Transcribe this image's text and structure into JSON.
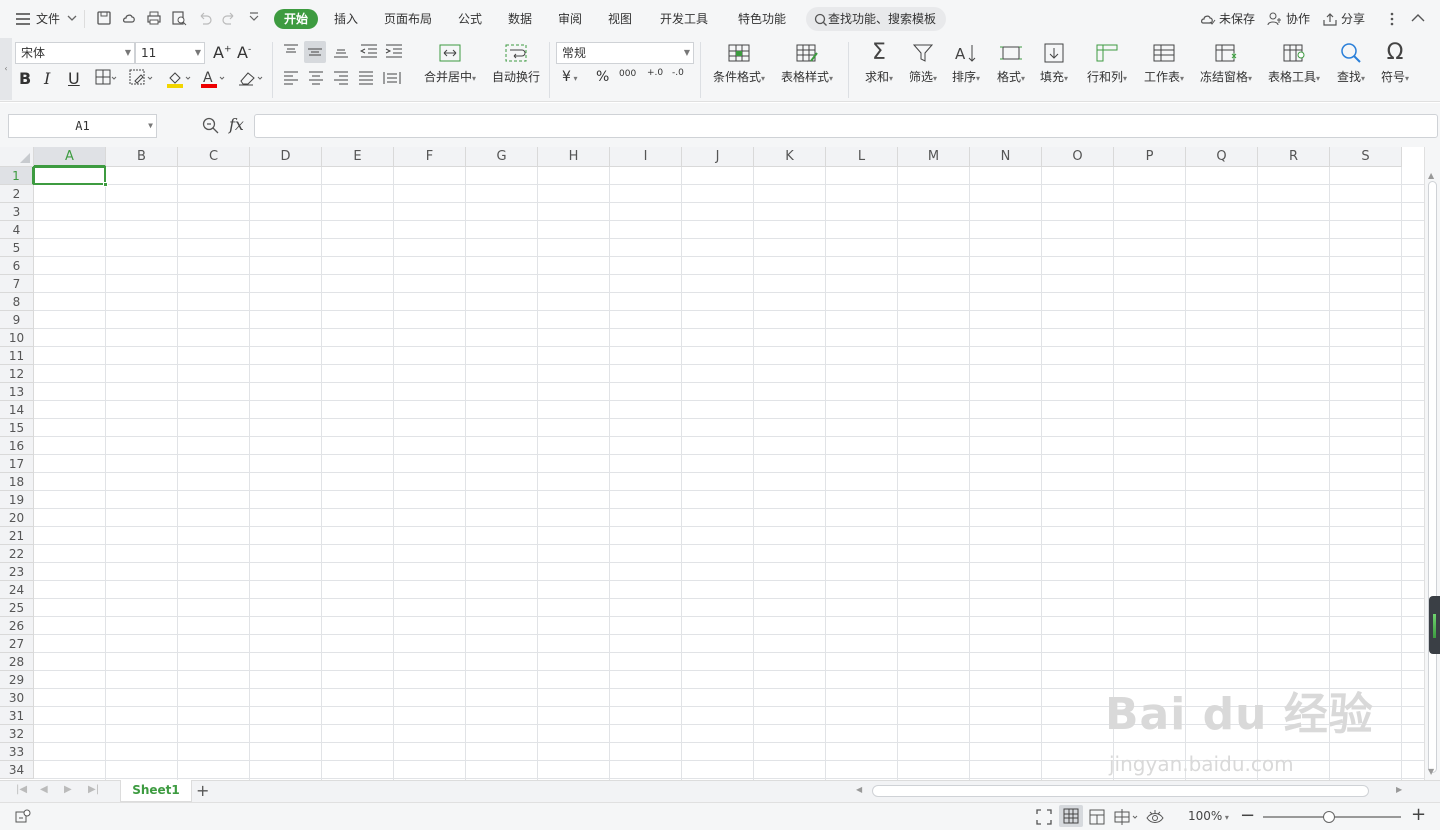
{
  "titlebar": {
    "file_menu": "文件",
    "tabs": [
      "开始",
      "插入",
      "页面布局",
      "公式",
      "数据",
      "审阅",
      "视图",
      "开发工具",
      "特色功能"
    ],
    "search_placeholder": "查找功能、搜索模板",
    "unsaved": "未保存",
    "collaborate": "协作",
    "share": "分享"
  },
  "ribbon": {
    "font_name": "宋体",
    "font_size": "11",
    "merge_center": "合并居中",
    "wrap_text": "自动换行",
    "number_format": "常规",
    "currency_symbol": "¥",
    "percent_symbol": "%",
    "thousands_symbol": "000",
    "decimal_increase": "+.0",
    "decimal_decrease": "-.0",
    "conditional_format": "条件格式",
    "table_style": "表格样式",
    "sum": "求和",
    "filter": "筛选",
    "sort": "排序",
    "format": "格式",
    "fill": "填充",
    "row_col": "行和列",
    "worksheet": "工作表",
    "freeze": "冻结窗格",
    "table_tools": "表格工具",
    "find": "查找",
    "symbol": "符号"
  },
  "formula_bar": {
    "cell_ref": "A1",
    "fx_label": "fx",
    "value": ""
  },
  "sheet": {
    "columns": [
      "A",
      "B",
      "C",
      "D",
      "E",
      "F",
      "G",
      "H",
      "I",
      "J",
      "K",
      "L",
      "M",
      "N",
      "O",
      "P",
      "Q",
      "R",
      "S"
    ],
    "rows": [
      "1",
      "2",
      "3",
      "4",
      "5",
      "6",
      "7",
      "8",
      "9",
      "10",
      "11",
      "12",
      "13",
      "14",
      "15",
      "16",
      "17",
      "18",
      "19",
      "20",
      "21",
      "22",
      "23",
      "24",
      "25",
      "26",
      "27",
      "28",
      "29",
      "30",
      "31",
      "32",
      "33",
      "34"
    ],
    "active_cell": "A1"
  },
  "sheet_tabs": [
    "Sheet1"
  ],
  "status": {
    "zoom": "100%"
  },
  "watermark": {
    "brand": "Bai du 经验",
    "url": "jingyan.baidu.com"
  },
  "colors": {
    "accent": "#3d9b40",
    "grid_line": "#e1e3e6",
    "header_bg": "#f2f3f5"
  }
}
